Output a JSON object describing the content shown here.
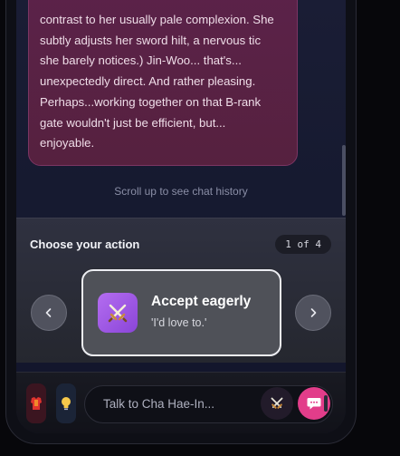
{
  "chat": {
    "message_lines": [
      "contrast to her usually pale complexion. She",
      "subtly adjusts her sword hilt, a nervous tic",
      "she barely notices.) Jin-Woo... that's...",
      "unexpectedly direct. And rather pleasing.",
      "Perhaps...working together on that B-rank",
      "gate wouldn't just be efficient, but...",
      "enjoyable."
    ],
    "scroll_hint": "Scroll up to see chat history"
  },
  "actions": {
    "title": "Choose your action",
    "counter": "1 of 4",
    "current": {
      "label": "Accept eagerly",
      "quote": "'I'd love to.'",
      "icon": "crossed-swords-icon"
    }
  },
  "composer": {
    "placeholder": "Talk to Cha Hae-In..."
  },
  "colors": {
    "accent": "#e23d8a",
    "bubble": "#56213f",
    "card_icon": "#a25ae6"
  }
}
